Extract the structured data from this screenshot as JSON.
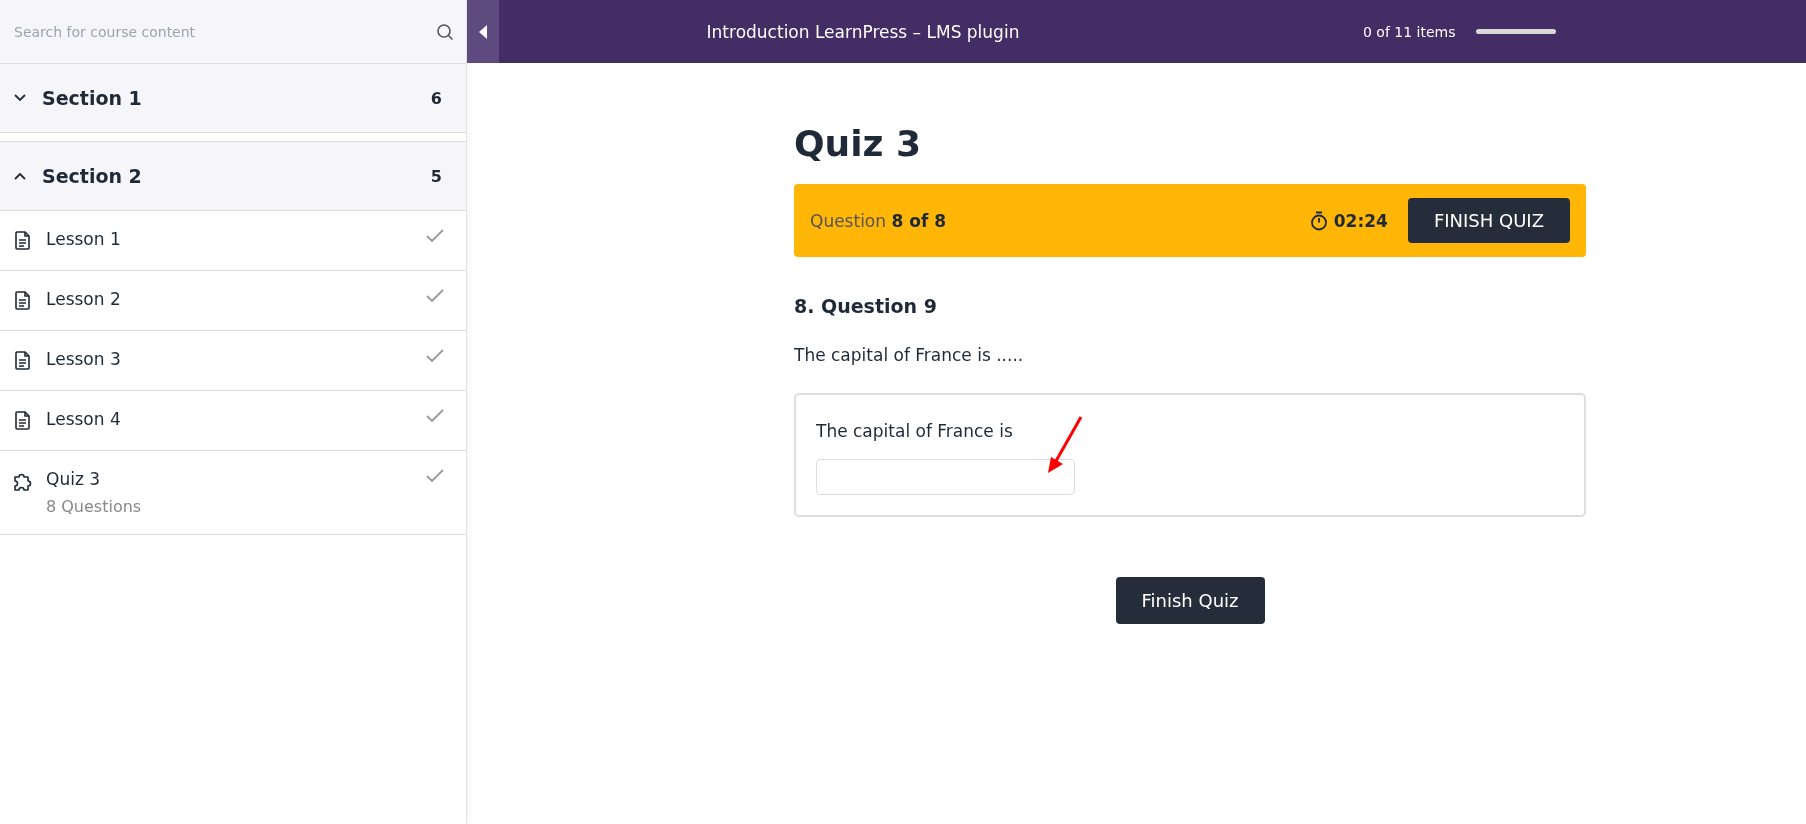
{
  "sidebar": {
    "search": {
      "placeholder": "Search for course content"
    },
    "sections": [
      {
        "title": "Section 1",
        "count": "6",
        "expanded": false
      },
      {
        "title": "Section 2",
        "count": "5",
        "expanded": true,
        "items": [
          {
            "kind": "lesson",
            "title": "Lesson 1",
            "completed": true
          },
          {
            "kind": "lesson",
            "title": "Lesson 2",
            "completed": true
          },
          {
            "kind": "lesson",
            "title": "Lesson 3",
            "completed": true
          },
          {
            "kind": "lesson",
            "title": "Lesson 4",
            "completed": true
          },
          {
            "kind": "quiz",
            "title": "Quiz 3",
            "meta": "8 Questions",
            "completed": true
          }
        ]
      }
    ]
  },
  "header": {
    "title": "Introduction LearnPress – LMS plugin",
    "progress_text": "0 of 11 items"
  },
  "quiz": {
    "title": "Quiz 3",
    "status_label": "Question",
    "status_value": "8 of 8",
    "timer": "02:24",
    "finish_top": "FINISH QUIZ",
    "question_title": "8. Question 9",
    "question_text": "The capital of France is .....",
    "answer_prompt": "The capital of France is",
    "finish_bottom": "Finish Quiz"
  }
}
